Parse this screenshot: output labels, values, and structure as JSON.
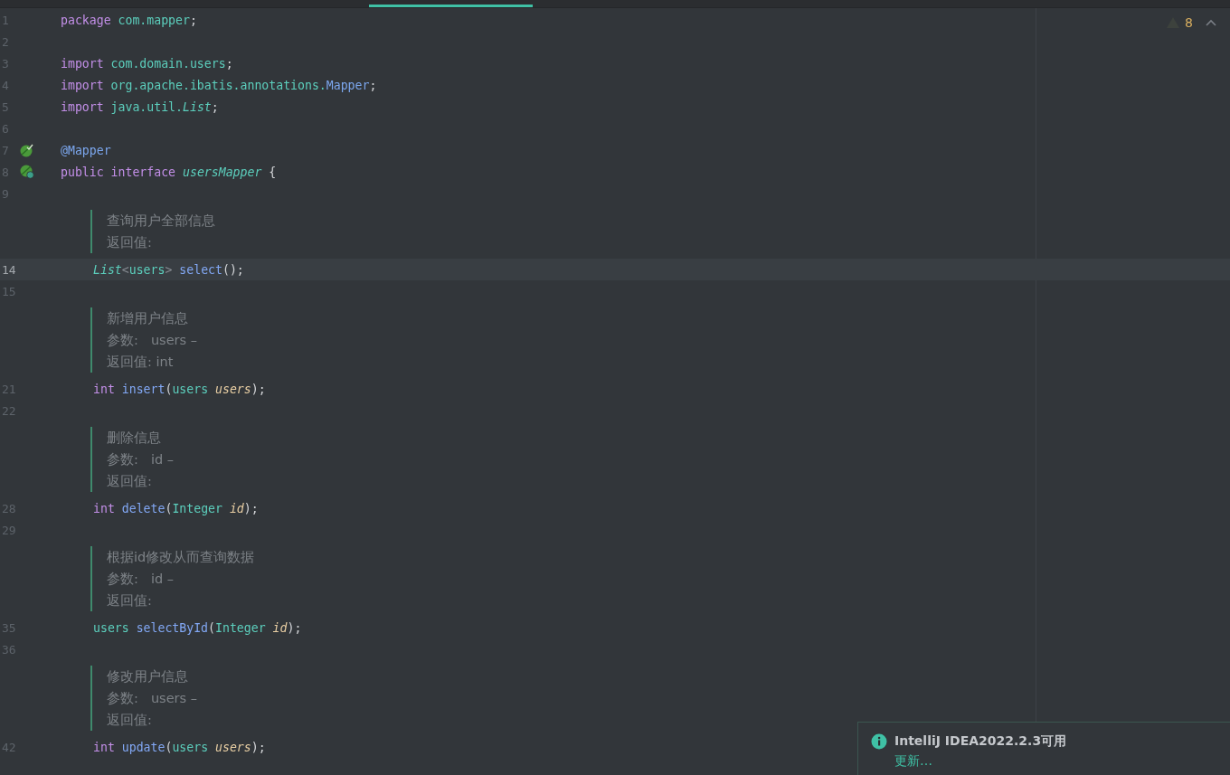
{
  "inspection": {
    "count": "8"
  },
  "lines": [
    {
      "num": "1",
      "current": false,
      "words": [
        [
          {
            "kind": "keyword",
            "text": "package"
          }
        ],
        [
          {
            "kind": "package",
            "text": "com.mapper"
          },
          {
            "kind": "punct",
            "text": ";"
          }
        ]
      ]
    },
    {
      "num": "2",
      "current": false
    },
    {
      "num": "3",
      "current": false,
      "words": [
        [
          {
            "kind": "keyword",
            "text": "import"
          }
        ],
        [
          {
            "kind": "package",
            "text": "com.domain.users"
          },
          {
            "kind": "punct",
            "text": ";"
          }
        ]
      ]
    },
    {
      "num": "4",
      "current": false,
      "words": [
        [
          {
            "kind": "keyword",
            "text": "import"
          }
        ],
        [
          {
            "kind": "package",
            "text": "org.apache.ibatis.annotations."
          },
          {
            "kind": "annotation",
            "text": "Mapper"
          },
          {
            "kind": "punct",
            "text": ";"
          }
        ]
      ]
    },
    {
      "num": "5",
      "current": false,
      "words": [
        [
          {
            "kind": "keyword",
            "text": "import"
          }
        ],
        [
          {
            "kind": "package",
            "text": "java.util."
          },
          {
            "kind": "italic-type",
            "text": "List"
          },
          {
            "kind": "punct",
            "text": ";"
          }
        ]
      ]
    },
    {
      "num": "6",
      "current": false
    },
    {
      "num": "7",
      "current": false,
      "gutter": {
        "kind": "check"
      },
      "words": [
        [
          {
            "kind": "annotation",
            "text": "@Mapper"
          }
        ]
      ]
    },
    {
      "num": "8",
      "current": false,
      "gutter": {
        "kind": "badge"
      },
      "words": [
        [
          {
            "kind": "keyword",
            "text": "public"
          }
        ],
        [
          {
            "kind": "keyword",
            "text": "interface"
          }
        ],
        [
          {
            "kind": "italic-type",
            "text": "usersMapper"
          }
        ],
        [
          {
            "kind": "punct",
            "text": "{"
          }
        ]
      ],
      "children": [
        {
          "num": "9",
          "current": false
        },
        {
          "kind": "doc",
          "rows": [
            {
              "label": "查询用户全部信息"
            },
            {
              "label": "返回值:"
            }
          ]
        },
        {
          "num": "14",
          "current": true,
          "words": [
            [
              {
                "kind": "italic-type",
                "text": "List"
              },
              {
                "kind": "generic",
                "text": "<"
              },
              {
                "kind": "type",
                "text": "users"
              },
              {
                "kind": "generic",
                "text": ">"
              }
            ],
            [
              {
                "kind": "method",
                "text": "select"
              },
              {
                "kind": "punct",
                "text": "();"
              }
            ]
          ]
        },
        {
          "num": "15",
          "current": false
        },
        {
          "kind": "doc",
          "rows": [
            {
              "label": "新增用户信息"
            },
            {
              "label": "参数:",
              "value": "users –"
            },
            {
              "label": "返回值:",
              "inline": "int"
            }
          ]
        },
        {
          "num": "21",
          "current": false,
          "words": [
            [
              {
                "kind": "keyword",
                "text": "int"
              }
            ],
            [
              {
                "kind": "method",
                "text": "insert"
              },
              {
                "kind": "punct",
                "text": "("
              },
              {
                "kind": "type",
                "text": "users"
              }
            ],
            [
              {
                "kind": "param",
                "text": "users"
              },
              {
                "kind": "punct",
                "text": ");"
              }
            ]
          ]
        },
        {
          "num": "22",
          "current": false
        },
        {
          "kind": "doc",
          "rows": [
            {
              "label": "删除信息"
            },
            {
              "label": "参数:",
              "value": "id –"
            },
            {
              "label": "返回值:"
            }
          ]
        },
        {
          "num": "28",
          "current": false,
          "words": [
            [
              {
                "kind": "keyword",
                "text": "int"
              }
            ],
            [
              {
                "kind": "method",
                "text": "delete"
              },
              {
                "kind": "punct",
                "text": "("
              },
              {
                "kind": "type",
                "text": "Integer"
              }
            ],
            [
              {
                "kind": "param",
                "text": "id"
              },
              {
                "kind": "punct",
                "text": ");"
              }
            ]
          ]
        },
        {
          "num": "29",
          "current": false
        },
        {
          "kind": "doc",
          "rows": [
            {
              "label": "根据id修改从而查询数据"
            },
            {
              "label": "参数:",
              "value": "id –"
            },
            {
              "label": "返回值:"
            }
          ]
        },
        {
          "num": "35",
          "current": false,
          "words": [
            [
              {
                "kind": "type",
                "text": "users"
              }
            ],
            [
              {
                "kind": "method",
                "text": "selectById"
              },
              {
                "kind": "punct",
                "text": "("
              },
              {
                "kind": "type",
                "text": "Integer"
              }
            ],
            [
              {
                "kind": "param",
                "text": "id"
              },
              {
                "kind": "punct",
                "text": ");"
              }
            ]
          ]
        },
        {
          "num": "36",
          "current": false
        },
        {
          "kind": "doc",
          "rows": [
            {
              "label": "修改用户信息"
            },
            {
              "label": "参数:",
              "value": "users –"
            },
            {
              "label": "返回值:"
            }
          ]
        },
        {
          "num": "42",
          "current": false,
          "words": [
            [
              {
                "kind": "keyword",
                "text": "int"
              }
            ],
            [
              {
                "kind": "method",
                "text": "update"
              },
              {
                "kind": "punct",
                "text": "("
              },
              {
                "kind": "type",
                "text": "users"
              }
            ],
            [
              {
                "kind": "param",
                "text": "users"
              },
              {
                "kind": "punct",
                "text": ");"
              }
            ]
          ]
        }
      ]
    }
  ],
  "notification": {
    "title": "IntelliJ IDEA2022.2.3可用",
    "action": "更新…"
  }
}
